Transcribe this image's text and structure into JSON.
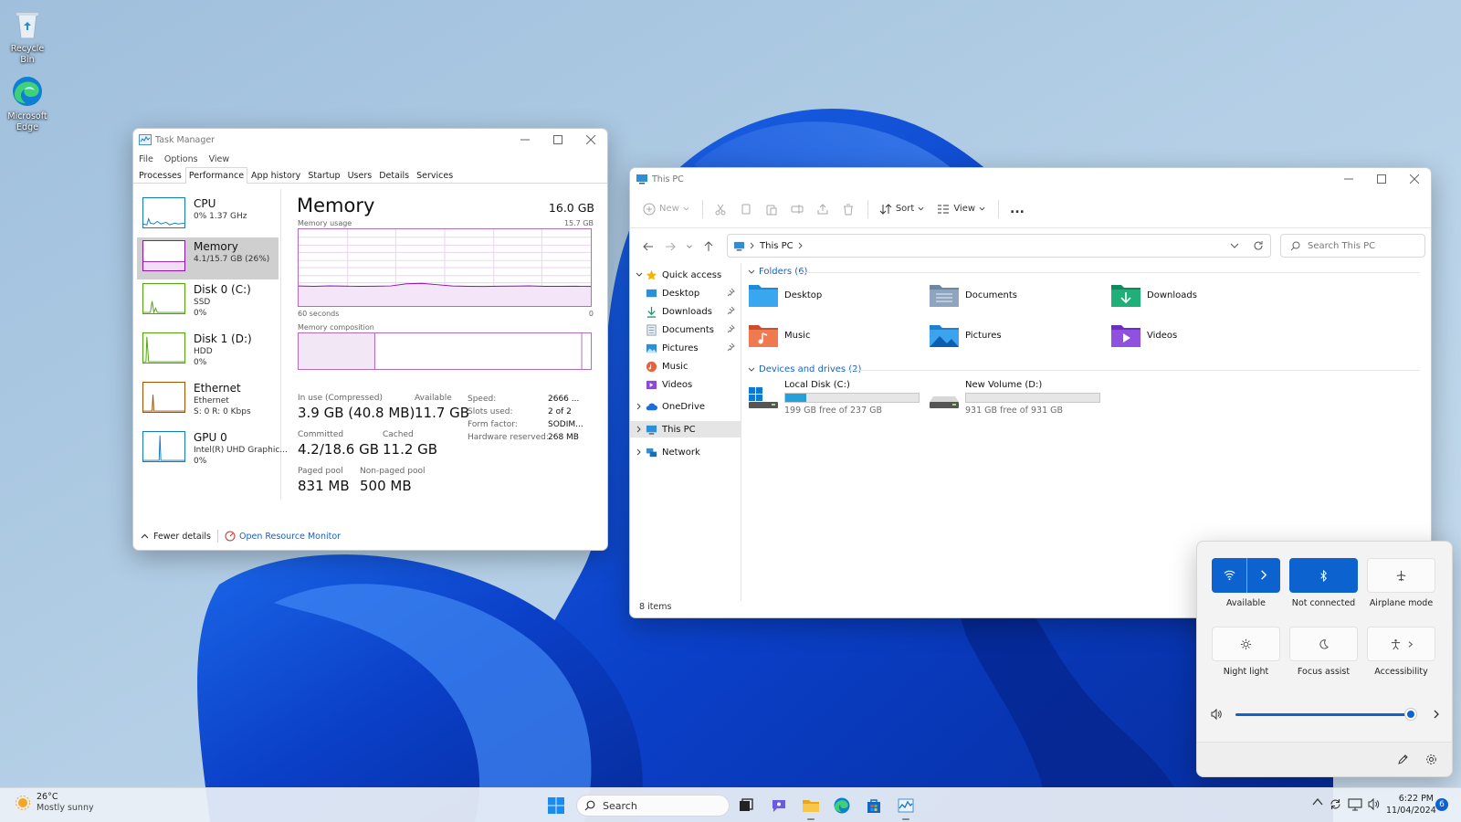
{
  "desktop": {
    "icons": [
      {
        "label": "Recycle Bin"
      },
      {
        "label": "Microsoft Edge"
      }
    ]
  },
  "taskmgr": {
    "title": "Task Manager",
    "menu": [
      "File",
      "Options",
      "View"
    ],
    "tabs": [
      "Processes",
      "Performance",
      "App history",
      "Startup",
      "Users",
      "Details",
      "Services"
    ],
    "active_tab": "Performance",
    "sidebar": [
      {
        "name": "CPU",
        "line1": "0% 1.37 GHz",
        "line2": "",
        "color": "#117dbb"
      },
      {
        "name": "Memory",
        "line1": "4.1/15.7 GB (26%)",
        "line2": "",
        "color": "#8b12ae"
      },
      {
        "name": "Disk 0 (C:)",
        "line1": "SSD",
        "line2": "0%",
        "color": "#4da60c"
      },
      {
        "name": "Disk 1 (D:)",
        "line1": "HDD",
        "line2": "0%",
        "color": "#4da60c"
      },
      {
        "name": "Ethernet",
        "line1": "Ethernet",
        "line2": "S: 0 R: 0 Kbps",
        "color": "#a74f01"
      },
      {
        "name": "GPU 0",
        "line1": "Intel(R) UHD Graphic...",
        "line2": "0%",
        "color": "#117dbb"
      }
    ],
    "detail": {
      "title": "Memory",
      "total": "16.0 GB",
      "usage_label": "Memory usage",
      "usage_max": "15.7 GB",
      "time_label": "60 seconds",
      "zero": "0",
      "comp_label": "Memory composition",
      "in_use_label": "In use (Compressed)",
      "in_use_value": "3.9 GB (40.8 MB)",
      "available_label": "Available",
      "available_value": "11.7 GB",
      "committed_label": "Committed",
      "committed_value": "4.2/18.6 GB",
      "cached_label": "Cached",
      "cached_value": "11.2 GB",
      "paged_label": "Paged pool",
      "paged_value": "831 MB",
      "nonpaged_label": "Non-paged pool",
      "nonpaged_value": "500 MB",
      "speed_label": "Speed:",
      "speed_value": "2666 ...",
      "slots_label": "Slots used:",
      "slots_value": "2 of 2",
      "form_label": "Form factor:",
      "form_value": "SODIM...",
      "hw_label": "Hardware reserved:",
      "hw_value": "268 MB",
      "usage_fraction": 0.26
    },
    "footer": {
      "fewer": "Fewer details",
      "resmon": "Open Resource Monitor"
    }
  },
  "explorer": {
    "title": "This PC",
    "toolbar": {
      "new": "New",
      "sort": "Sort",
      "view": "View",
      "more": "..."
    },
    "breadcrumb": "This PC",
    "search_placeholder": "Search This PC",
    "sidebar": [
      {
        "label": "Quick access"
      },
      {
        "label": "Desktop"
      },
      {
        "label": "Downloads"
      },
      {
        "label": "Documents"
      },
      {
        "label": "Pictures"
      },
      {
        "label": "Music"
      },
      {
        "label": "Videos"
      },
      {
        "label": "OneDrive"
      },
      {
        "label": "This PC"
      },
      {
        "label": "Network"
      }
    ],
    "folders_header": "Folders (6)",
    "folders": [
      {
        "label": "Desktop"
      },
      {
        "label": "Documents"
      },
      {
        "label": "Downloads"
      },
      {
        "label": "Music"
      },
      {
        "label": "Pictures"
      },
      {
        "label": "Videos"
      }
    ],
    "drives_header": "Devices and drives (2)",
    "drives": [
      {
        "label": "Local Disk (C:)",
        "free": "199 GB free of 237 GB",
        "used_fraction": 0.16
      },
      {
        "label": "New Volume (D:)",
        "free": "931 GB free of 931 GB",
        "used_fraction": 0.0
      }
    ],
    "status": "8 items"
  },
  "quick_settings": {
    "tiles": [
      {
        "label": "Available",
        "icon": "wifi-icon",
        "state": "on"
      },
      {
        "label": "Not connected",
        "icon": "bluetooth-icon",
        "state": "on"
      },
      {
        "label": "Airplane mode",
        "icon": "airplane-icon",
        "state": "off"
      },
      {
        "label": "Night light",
        "icon": "sun-icon",
        "state": "off"
      },
      {
        "label": "Focus assist",
        "icon": "moon-icon",
        "state": "off"
      },
      {
        "label": "Accessibility",
        "icon": "accessibility-icon",
        "state": "off"
      }
    ],
    "volume_level": 0.98,
    "accent": "#0c63cf"
  },
  "taskbar": {
    "weather_temp": "26°C",
    "weather_desc": "Mostly sunny",
    "search_label": "Search",
    "time": "6:22 PM",
    "date": "11/04/2024",
    "notifications": "6"
  }
}
